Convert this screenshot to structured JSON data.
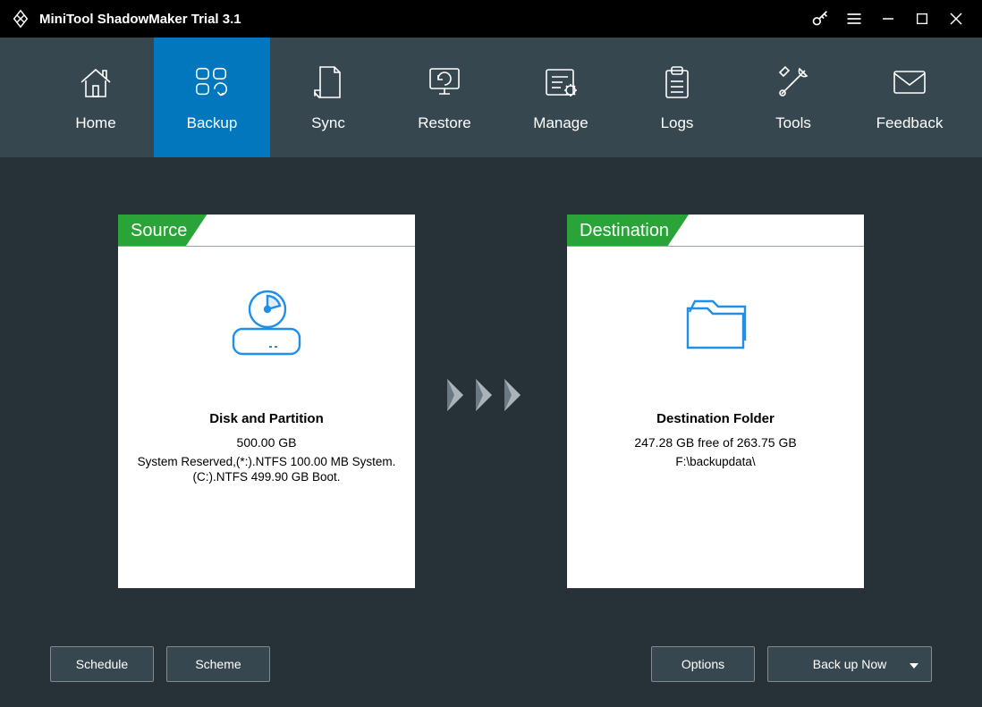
{
  "titlebar": {
    "title": "MiniTool ShadowMaker Trial 3.1"
  },
  "nav": {
    "items": [
      {
        "label": "Home"
      },
      {
        "label": "Backup"
      },
      {
        "label": "Sync"
      },
      {
        "label": "Restore"
      },
      {
        "label": "Manage"
      },
      {
        "label": "Logs"
      },
      {
        "label": "Tools"
      },
      {
        "label": "Feedback"
      }
    ]
  },
  "source": {
    "tab": "Source",
    "title": "Disk and Partition",
    "size": "500.00 GB",
    "detail1": "System Reserved,(*:).NTFS 100.00 MB System.",
    "detail2": "(C:).NTFS 499.90 GB Boot."
  },
  "destination": {
    "tab": "Destination",
    "title": "Destination Folder",
    "free": "247.28 GB free of 263.75 GB",
    "path": "F:\\backupdata\\"
  },
  "buttons": {
    "schedule": "Schedule",
    "scheme": "Scheme",
    "options": "Options",
    "backup_now": "Back up Now"
  }
}
